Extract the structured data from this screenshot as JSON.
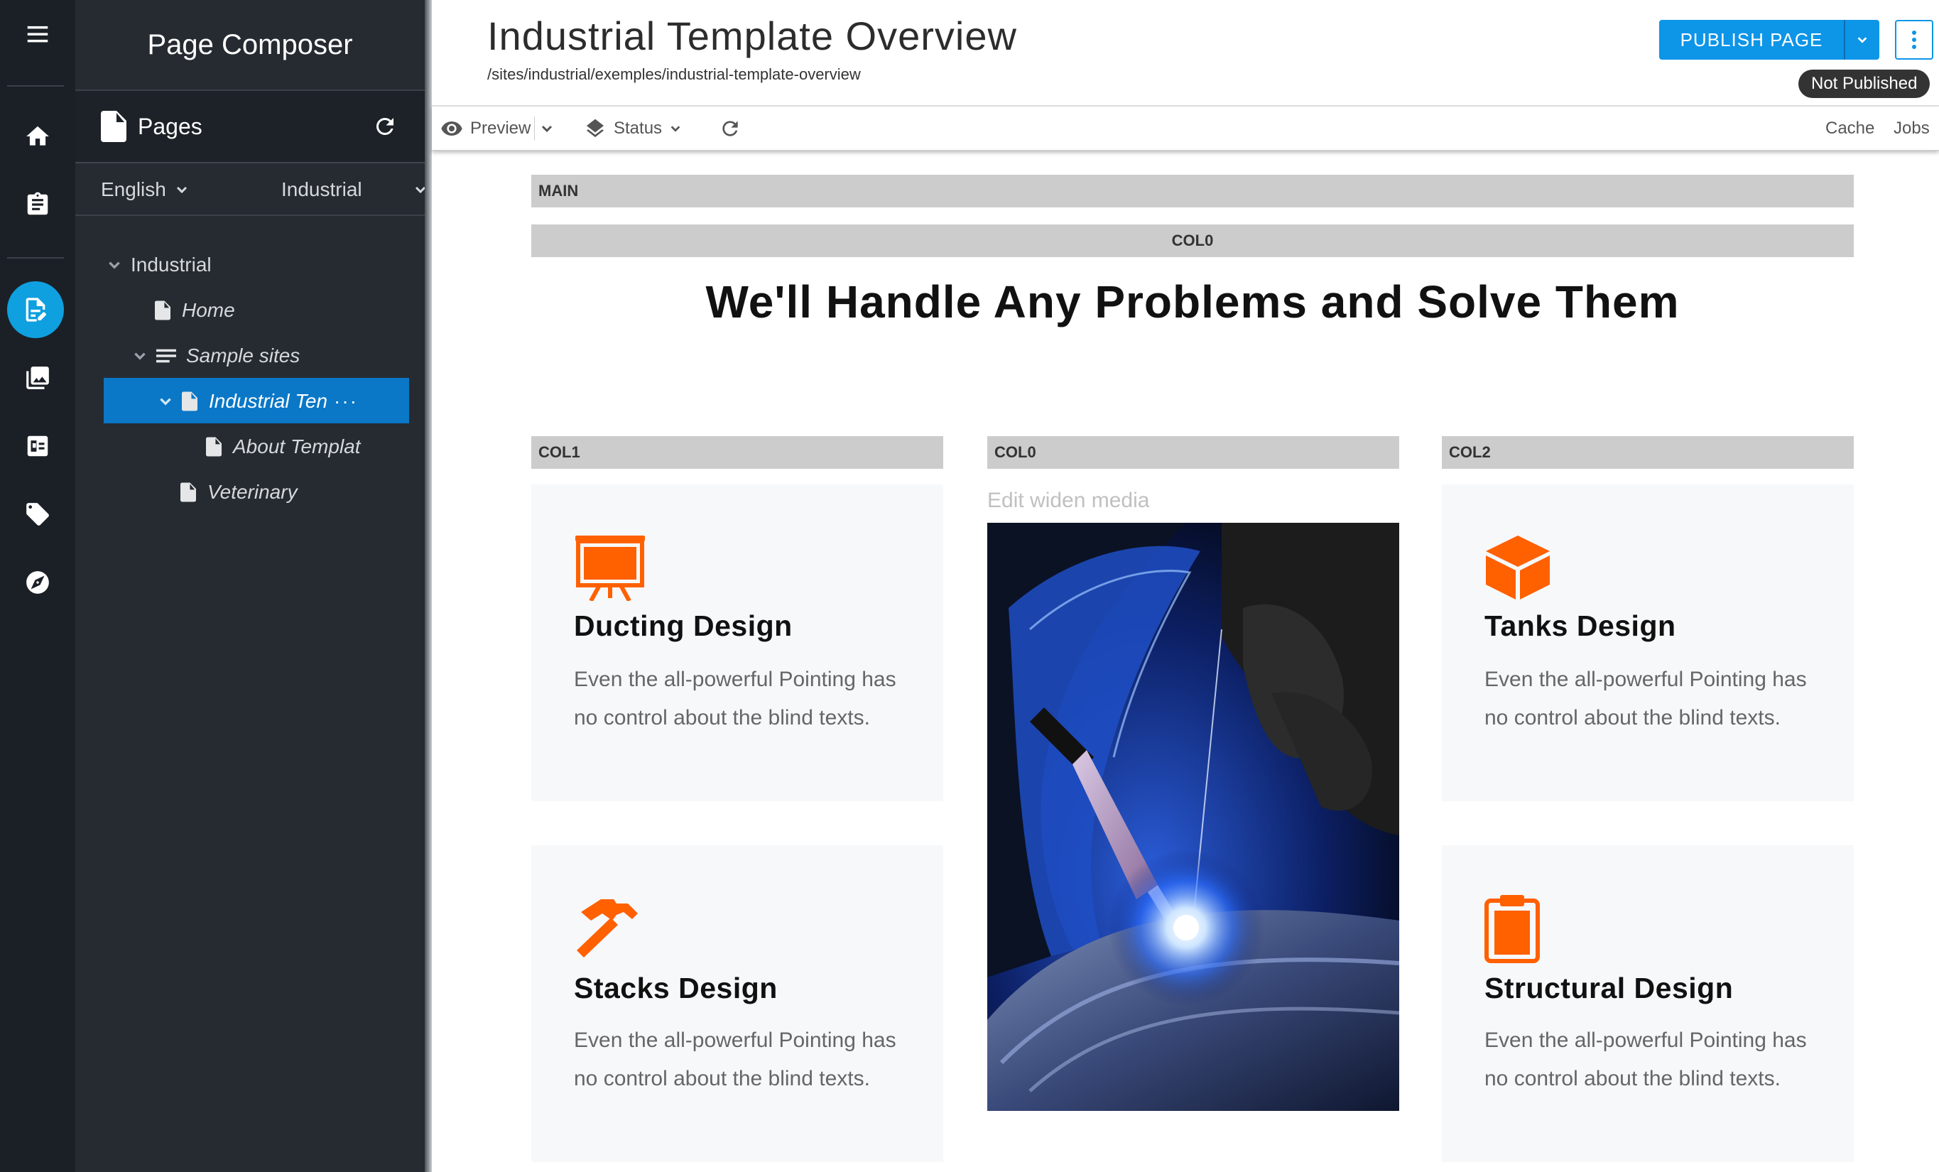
{
  "rail": {
    "items": [
      "menu-icon",
      "home-icon",
      "clipboard-icon",
      "page-composer-icon",
      "media-icon",
      "content-icon",
      "tag-icon",
      "compass-icon"
    ],
    "active_color": "#0fa0e0"
  },
  "sidebar": {
    "title": "Page Composer",
    "pages_label": "Pages",
    "language": "English",
    "site": "Industrial",
    "tree": [
      {
        "label": "Industrial",
        "level": 0
      },
      {
        "label": "Home",
        "level": 1
      },
      {
        "label": "Sample sites",
        "level": 1
      },
      {
        "label": "Industrial Ten",
        "level": 2,
        "selected": true
      },
      {
        "label": "About Templat",
        "level": 3
      },
      {
        "label": "Veterinary",
        "level": 1
      }
    ],
    "more_label": "···"
  },
  "header": {
    "title": "Industrial Template Overview",
    "path": "/sites/industrial/exemples/industrial-template-overview",
    "publish_label": "PUBLISH PAGE",
    "status": "Not Published",
    "accent": "#0d95e8"
  },
  "toolbar": {
    "preview": "Preview",
    "status": "Status",
    "cache": "Cache",
    "jobs": "Jobs"
  },
  "canvas": {
    "main_label": "MAIN",
    "col0_label": "COL0",
    "headline": "We'll Handle Any Problems and Solve Them",
    "col1_label": "COL1",
    "col0b_label": "COL0",
    "col2_label": "COL2",
    "media_label": "Edit widen media",
    "icon_color": "#ff6000",
    "cards": [
      {
        "title": "Ducting Design",
        "text": "Even the all-powerful Pointing has no control about the blind texts.",
        "icon": "easel-icon"
      },
      {
        "title": "Tanks Design",
        "text": "Even the all-powerful Pointing has no control about the blind texts.",
        "icon": "cube-icon"
      },
      {
        "title": "Stacks Design",
        "text": "Even the all-powerful Pointing has no control about the blind texts.",
        "icon": "hammer-icon"
      },
      {
        "title": "Structural Design",
        "text": "Even the all-powerful Pointing has no control about the blind texts.",
        "icon": "clipboard-icon"
      }
    ]
  }
}
